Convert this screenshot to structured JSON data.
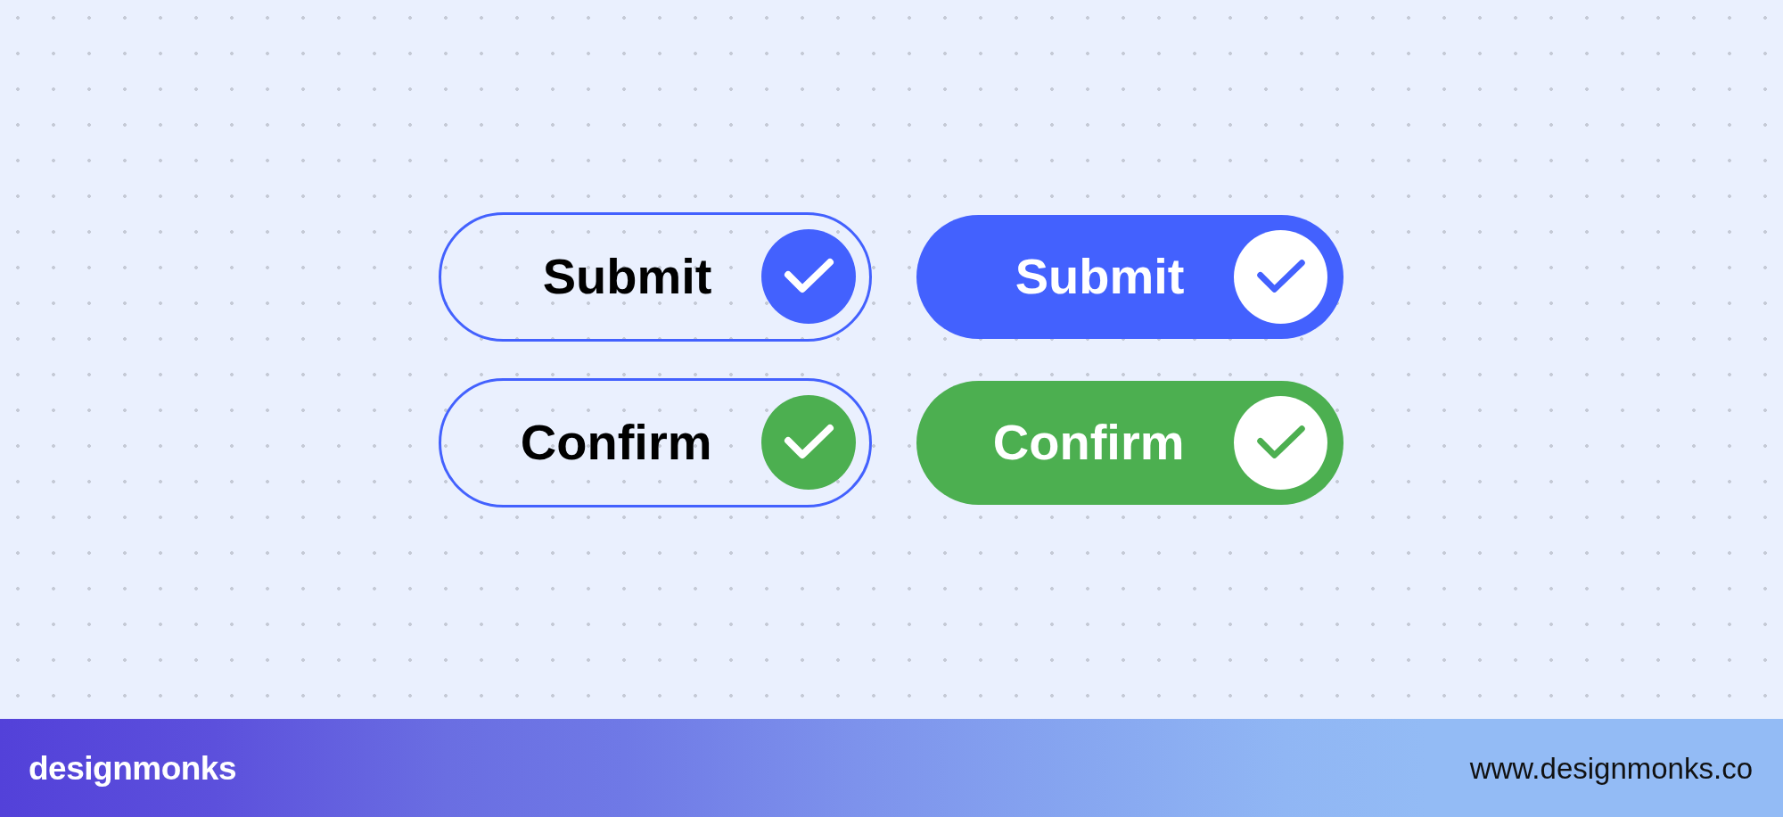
{
  "buttons": [
    {
      "label": "Submit",
      "kind": "outlined",
      "color": "#4361fe"
    },
    {
      "label": "Submit",
      "kind": "filled",
      "color": "#4361fe"
    },
    {
      "label": "Confirm",
      "kind": "outlined",
      "color": "#4caf50"
    },
    {
      "label": "Confirm",
      "kind": "filled",
      "color": "#4caf50"
    }
  ],
  "footer": {
    "logo": "designmonks",
    "url": "www.designmonks.co"
  }
}
